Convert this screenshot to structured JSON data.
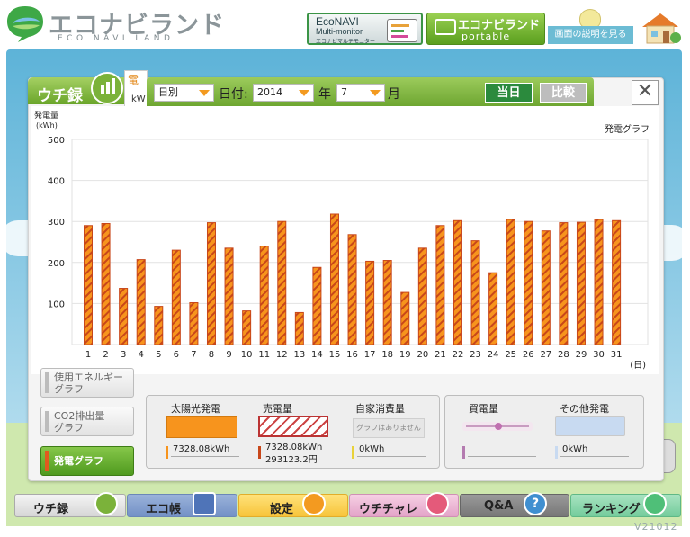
{
  "header": {
    "logo_title": "エコナビランド",
    "logo_subtitle": "ECO NAVI LAND",
    "econavi_button": {
      "line1": "EcoNAVI",
      "line2": "Multi-monitor",
      "line3": "エコナビマルチモニター"
    },
    "portable_button": {
      "line1": "エコナビランド",
      "line2": "portable"
    },
    "help_button": "画面の説明を見る"
  },
  "tab": {
    "label": "ウチ録",
    "peek_char": "電",
    "peek_unit": "kW"
  },
  "toolbar": {
    "period_select": "日別",
    "date_label": "日付:",
    "year_select": "2014",
    "year_label": "年",
    "month_select": "7",
    "month_label": "月",
    "today_button": "当日",
    "compare_button": "比較",
    "close_button": "✕"
  },
  "chart_data": {
    "type": "bar",
    "title": "発電グラフ",
    "ylabel_line1": "発電量",
    "ylabel_line2": "(kWh)",
    "xlabel": "(日)",
    "ylim": [
      0,
      500
    ],
    "yticks": [
      100,
      200,
      300,
      400,
      500
    ],
    "categories": [
      "1",
      "2",
      "3",
      "4",
      "5",
      "6",
      "7",
      "8",
      "9",
      "10",
      "11",
      "12",
      "13",
      "14",
      "15",
      "16",
      "17",
      "18",
      "19",
      "20",
      "21",
      "22",
      "23",
      "24",
      "25",
      "26",
      "27",
      "28",
      "29",
      "30",
      "31"
    ],
    "values": [
      290,
      295,
      137,
      207,
      93,
      230,
      102,
      297,
      235,
      82,
      240,
      300,
      78,
      188,
      318,
      268,
      203,
      205,
      127,
      235,
      290,
      302,
      253,
      175,
      305,
      300,
      277,
      297,
      298,
      305,
      302
    ],
    "colors": {
      "bar_fill": "#f7941d",
      "bar_stripe": "#c8471a",
      "grid": "#e2e2e2"
    }
  },
  "side_buttons": [
    {
      "line1": "使用エネルギー",
      "line2": "グラフ"
    },
    {
      "line1": "CO2排出量",
      "line2": "グラフ"
    },
    {
      "line1": "発電グラフ",
      "line2": ""
    }
  ],
  "legend": {
    "solar": {
      "title": "太陽光発電",
      "value": "7328.08kWh"
    },
    "sell": {
      "title": "売電量",
      "value": "7328.08kWh",
      "value2": "293123.2円"
    },
    "self": {
      "title": "自家消費量",
      "swatch_text": "グラフはありません",
      "value": "0kWh"
    },
    "buy": {
      "title": "買電量",
      "value": ""
    },
    "other": {
      "title": "その他発電",
      "value": "0kWh"
    }
  },
  "nav": {
    "uchiroku": "ウチ録",
    "ecochou": "エコ帳",
    "settei": "設定",
    "uchichare": "ウチチャレ",
    "qa": "Q&A",
    "ranking": "ランキング"
  },
  "version": "V21012"
}
